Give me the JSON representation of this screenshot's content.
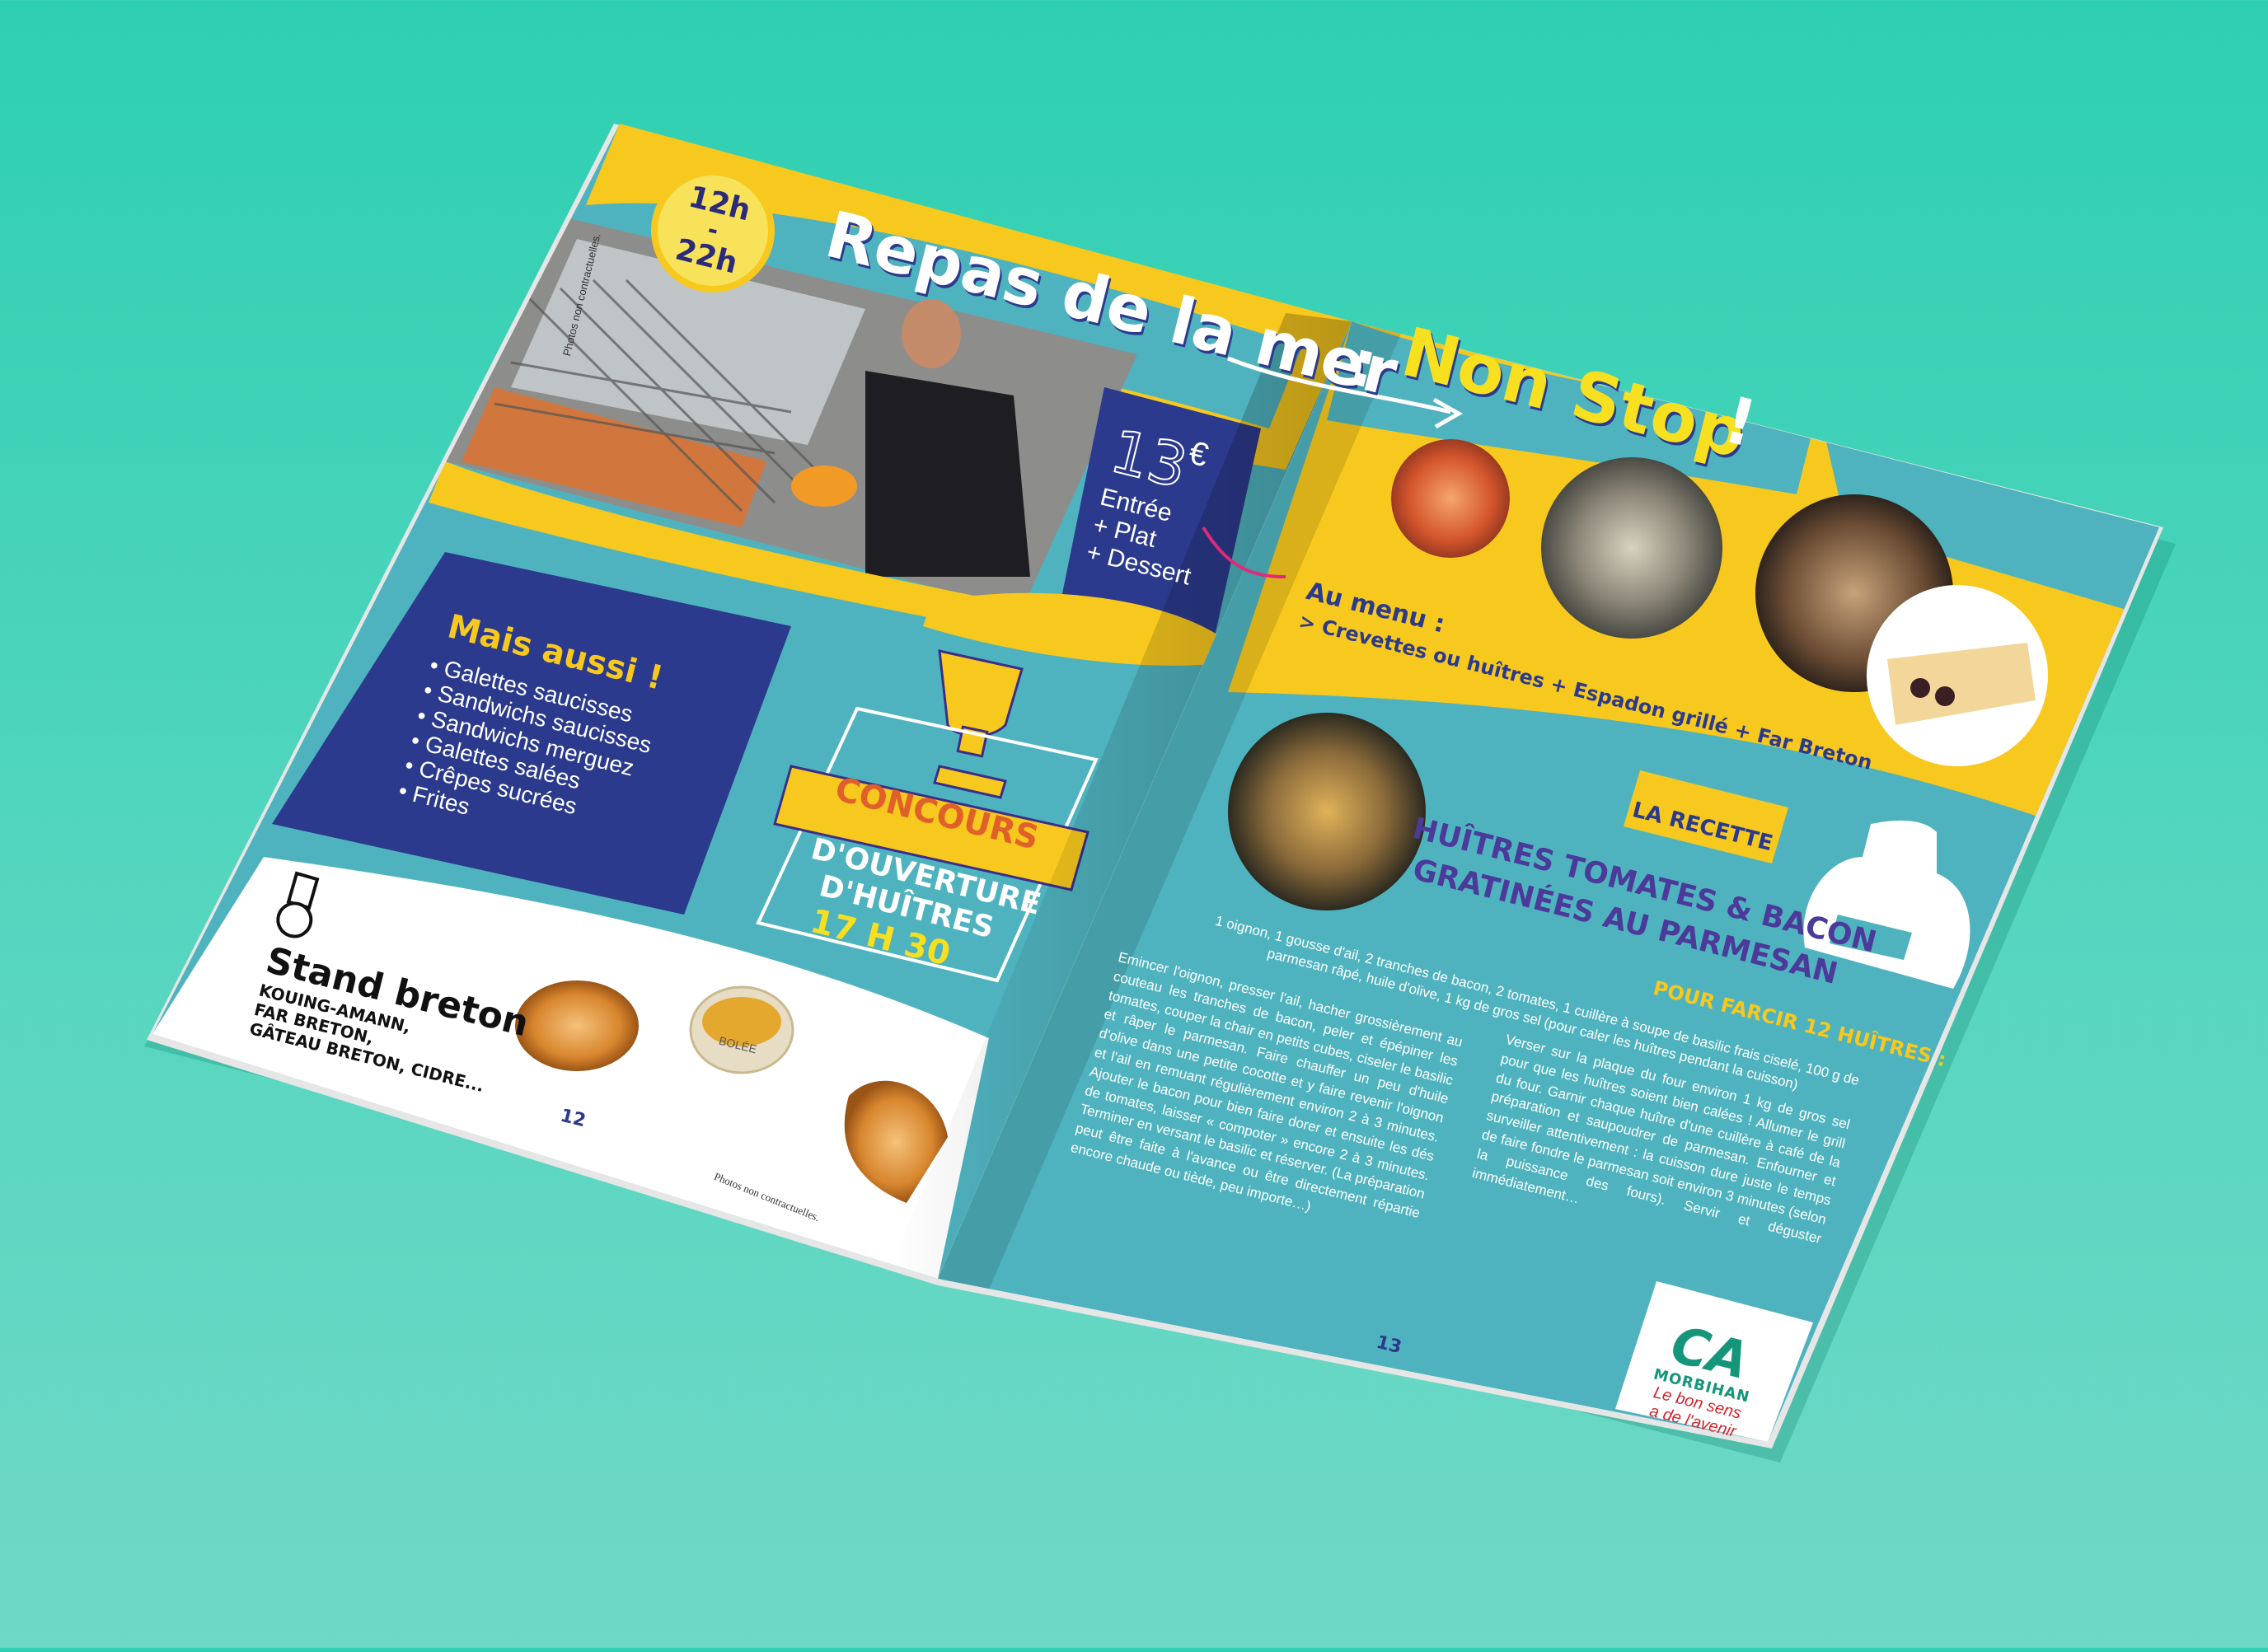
{
  "left_page": {
    "hours_badge": {
      "open": "12h",
      "dash": "-",
      "close": "22h"
    },
    "title_part1": "Repas de la mer",
    "price": {
      "amount": "13",
      "currency": "€",
      "lines": [
        "Entrée",
        "+ Plat",
        "+ Dessert"
      ]
    },
    "photo_caption": "Photos non contractuelles.",
    "mais_aussi": {
      "heading": "Mais aussi !",
      "items": [
        "Galettes saucisses",
        "Sandwichs saucisses",
        "Sandwichs merguez",
        "Galettes salées",
        "Crêpes sucrées",
        "Frites"
      ]
    },
    "concours": {
      "banner": "CONCOURS",
      "line1": "D'OUVERTURE",
      "line2": "D'HUÎTRES",
      "time": "17 H 30"
    },
    "stand": {
      "title": "Stand breton",
      "lines": [
        "KOUING-AMANN,",
        "FAR BRETON,",
        "GÂTEAU BRETON, CIDRE..."
      ]
    },
    "page_number": "12",
    "bowl_label": "BOLÉE",
    "photos_note": "Photos non contractuelles."
  },
  "right_page": {
    "title_part2": "Non Stop",
    "title_punct": ":",
    "title_end": "!",
    "menu": {
      "heading": "Au menu :",
      "line": "> Crevettes ou huîtres + Espadon grillé + Far Breton"
    },
    "recipe_label": "LA RECETTE",
    "recipe_title_line1": "HUÎTRES TOMATES & BACON",
    "recipe_title_line2": "GRATINÉES AU PARMESAN",
    "for_label": "POUR FARCIR 12 HUÎTRES :",
    "ingredients": "1 oignon, 1 gousse d'ail, 2 tranches de bacon, 2 tomates, 1 cuillère à soupe de basilic frais ciselé, 100 g de parmesan râpé, huile d'olive, 1 kg de gros sel (pour caler les huîtres pendant la cuisson)",
    "col1": "Emincer l'oignon, presser l'ail, hacher grossièrement au couteau les tranches de bacon, peler et épépiner les tomates, couper la chair en petits cubes, ciseler le basilic et râper le parmesan. Faire chauffer un peu d'huile d'olive dans une petite cocotte et y faire revenir l'oignon et l'ail en remuant régulièrement environ 2 à 3 minutes. Ajouter le bacon pour bien faire dorer et ensuite les dés de tomates, laisser « compoter » encore 2 à 3 minutes. Terminer en versant le basilic et réserver. (La préparation peut être faite à l'avance ou être directement répartie encore chaude ou tiède, peu importe…)",
    "col2": "Verser sur la plaque du four environ 1 kg de gros sel pour que les huîtres soient bien calées ! Allumer le grill du four. Garnir chaque huître d'une cuillère à café de la préparation et saupoudrer de parmesan. Enfourner et surveiller attentivement : la cuisson dure juste le temps de faire fondre le parmesan soit environ 3 minutes (selon la puissance des fours). Servir et déguster immédiatement…",
    "page_number": "13",
    "sponsor": {
      "logo": "CA",
      "name": "MORBIHAN",
      "slogan_line1": "Le bon sens",
      "slogan_line2": "a de l'avenir"
    }
  },
  "colors": {
    "background": "#2dcfb2",
    "teal": "#4fb3bf",
    "yellow": "#f7c81e",
    "navy": "#2b3a8c",
    "purple": "#4b3a9a",
    "orange": "#e8862b",
    "ca_green": "#15967a",
    "ca_red": "#d2232a"
  }
}
